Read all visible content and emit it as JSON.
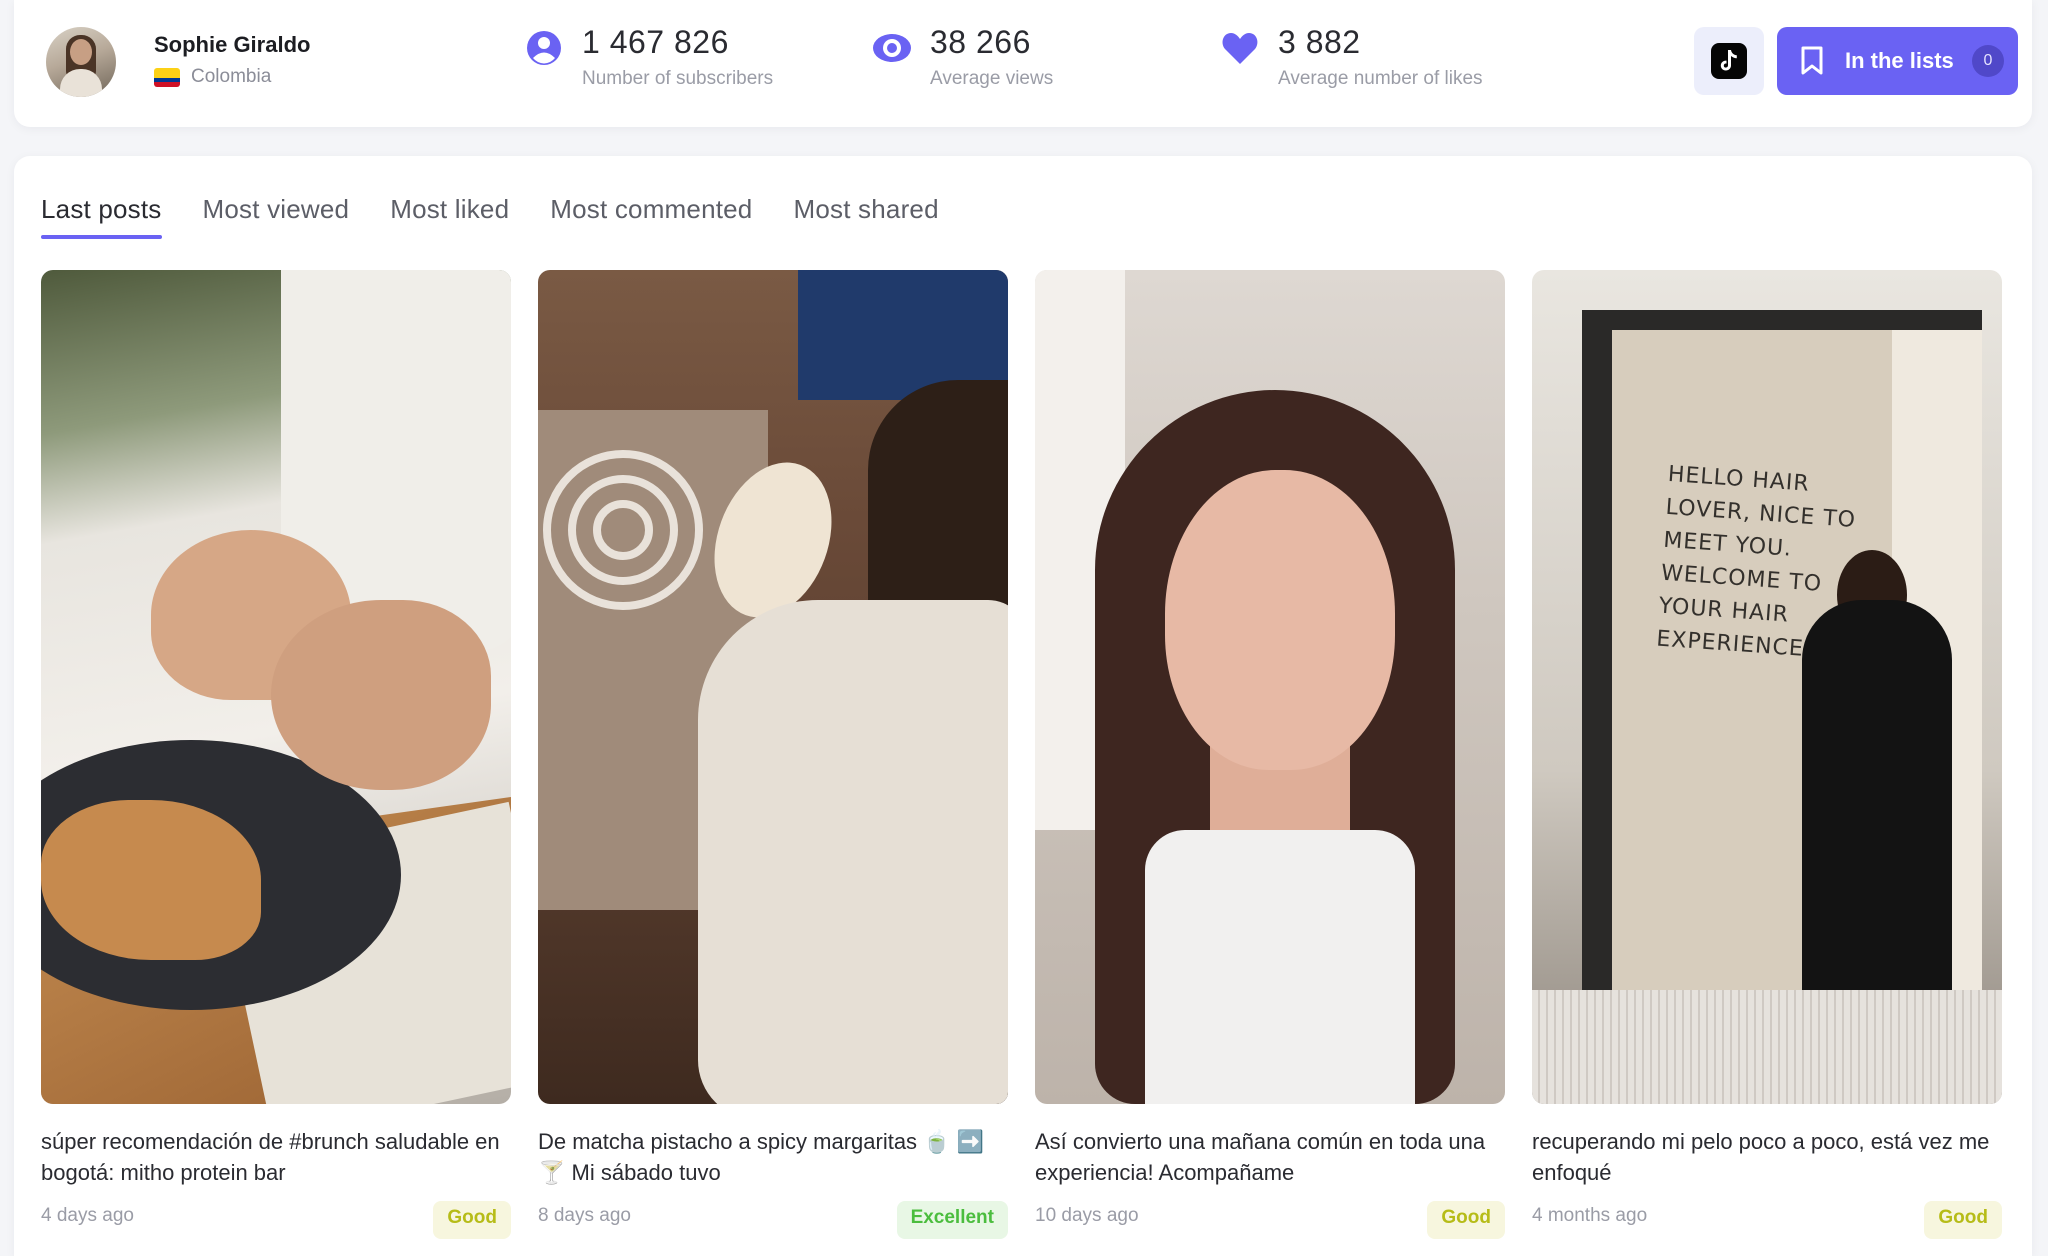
{
  "profile": {
    "name": "Sophie Giraldo",
    "country": "Colombia"
  },
  "stats": [
    {
      "icon": "user-icon",
      "value": "1 467 826",
      "label": "Number of subscribers"
    },
    {
      "icon": "eye-icon",
      "value": "38 266",
      "label": "Average views"
    },
    {
      "icon": "heart-icon",
      "value": "3 882",
      "label": "Average number of likes"
    }
  ],
  "actions": {
    "platform_icon": "tiktok-icon",
    "lists_label": "In the lists",
    "lists_count": "0"
  },
  "tabs": [
    {
      "label": "Last posts",
      "active": true
    },
    {
      "label": "Most viewed",
      "active": false
    },
    {
      "label": "Most liked",
      "active": false
    },
    {
      "label": "Most commented",
      "active": false
    },
    {
      "label": "Most shared",
      "active": false
    }
  ],
  "posts": [
    {
      "caption": "súper recomendación de #brunch saludable en bogotá: mitho protein bar",
      "age": "4 days ago",
      "rating": "Good"
    },
    {
      "caption": "De matcha pistacho a spicy margaritas 🍵 ➡️🍸 Mi sábado tuvo",
      "age": "8 days ago",
      "rating": "Excellent"
    },
    {
      "caption": "Así convierto una mañana común en toda una experiencia! Acompañame",
      "age": "10 days ago",
      "rating": "Good"
    },
    {
      "caption": "recuperando mi pelo poco a poco, está vez me enfoqué",
      "age": "4 months ago",
      "rating": "Good"
    }
  ],
  "thumbnail_text": {
    "door_sign": "HELLO HAIR LOVER, NICE TO MEET YOU. WELCOME TO YOUR HAIR EXPERIENCE."
  },
  "colors": {
    "accent": "#6a62f3",
    "good": "#b6bc18",
    "excellent": "#4bbd3e"
  }
}
